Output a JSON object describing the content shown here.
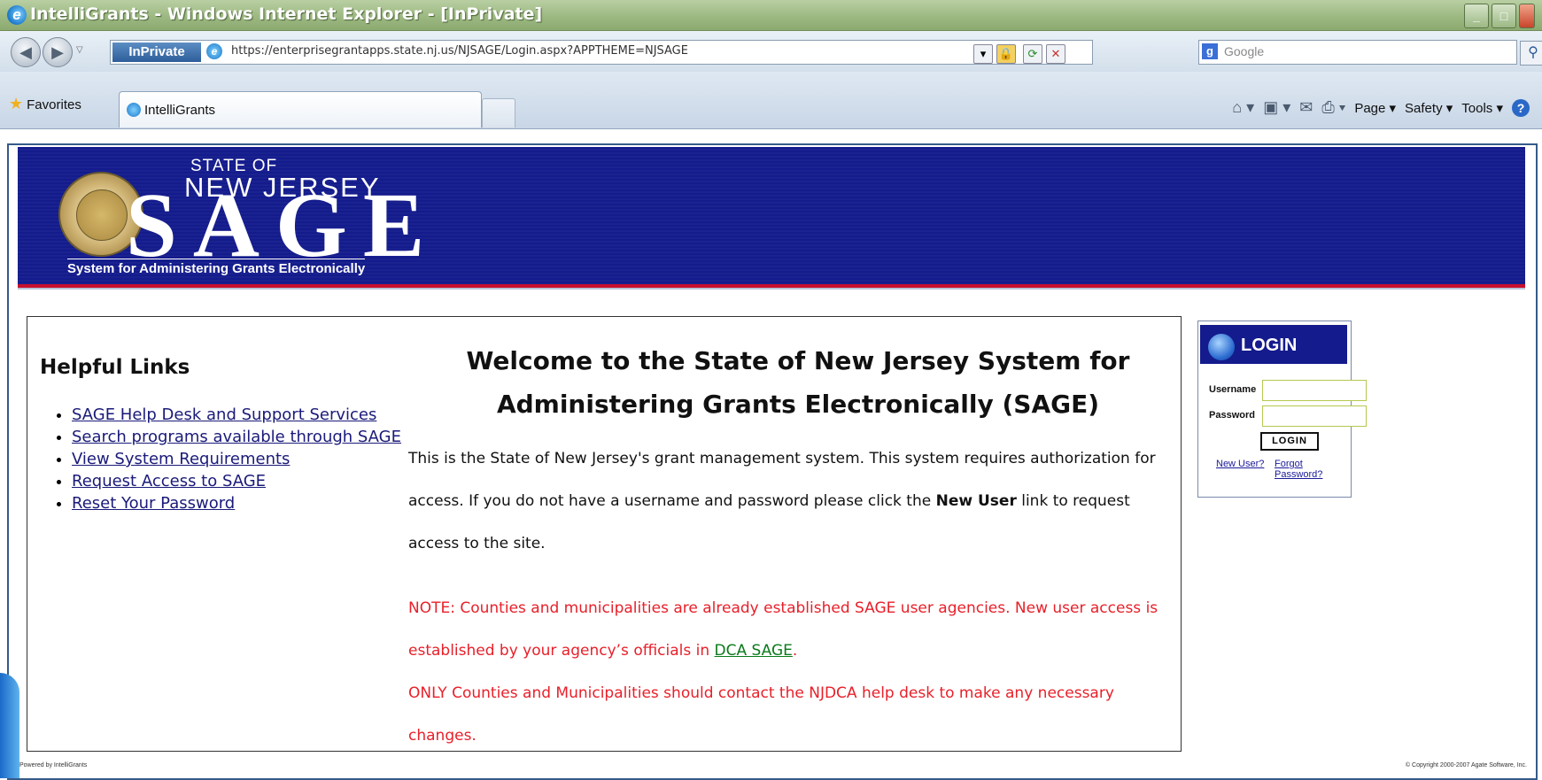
{
  "window": {
    "title": "IntelliGrants - Windows Internet Explorer - [InPrivate]",
    "controls": [
      "_",
      "□"
    ]
  },
  "address": {
    "inprivate_label": "InPrivate",
    "url": "https://enterprisegrantapps.state.nj.us/NJSAGE/Login.aspx?APPTHEME=NJSAGE",
    "search_placeholder": "Google"
  },
  "favorites": {
    "label": "Favorites",
    "tab_label": "IntelliGrants"
  },
  "commandbar": {
    "page": "Page ▾",
    "safety": "Safety ▾",
    "tools": "Tools ▾",
    "help": "?"
  },
  "banner": {
    "state_of": "STATE OF",
    "new_jersey": "NEW JERSEY",
    "sage": "SAGE",
    "tagline": "System for Administering Grants Electronically"
  },
  "helpful_links": {
    "title": "Helpful Links",
    "items": [
      "SAGE Help Desk and Support Services",
      "Search programs available through SAGE",
      "View System Requirements",
      "Request Access to SAGE",
      "Reset Your Password"
    ]
  },
  "welcome": {
    "title": "Welcome to the State of New Jersey System for Administering Grants Electronically (SAGE)",
    "intro_before": "This is the State of New Jersey's grant management system. This system requires authorization for access. If you do not have a username and password please click the ",
    "intro_bold": "New User",
    "intro_after": " link to request access to the site.",
    "note_line1": "NOTE: Counties and municipalities are already established SAGE user agencies. New user access is established by your agency’s officials in ",
    "note_link": "DCA SAGE",
    "note_line1_end": ".",
    "note_line2": "ONLY Counties and Municipalities should contact the NJDCA help desk to make any necessary changes."
  },
  "login": {
    "title": "LOGIN",
    "username_label": "Username",
    "password_label": "Password",
    "button": "LOGIN",
    "new_user": "New User?",
    "forgot": "Forgot Password?"
  },
  "footer": {
    "left": "Powered by IntelliGrants",
    "right": "© Copyright 2000-2007 Agate Software, Inc."
  }
}
